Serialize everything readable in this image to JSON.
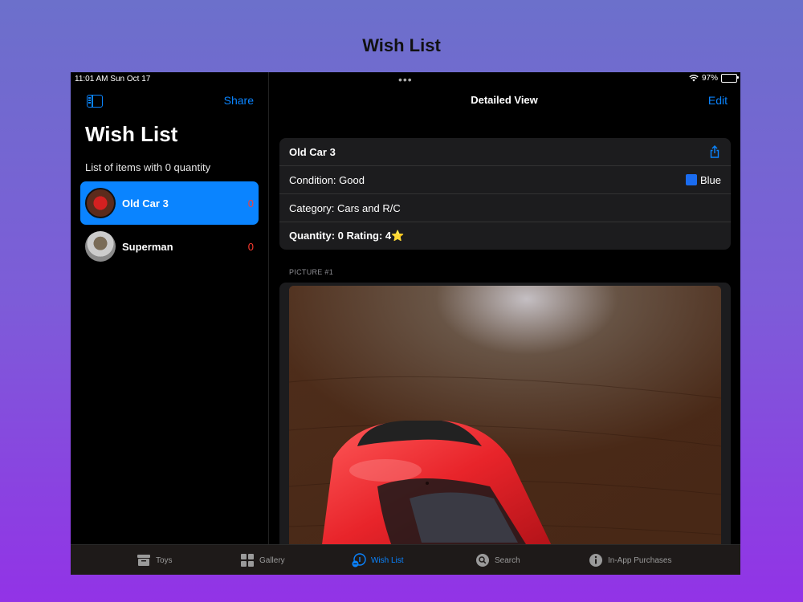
{
  "page": {
    "title": "Wish List"
  },
  "status_bar": {
    "time": "11:01 AM  Sun Oct 17",
    "battery": "97%",
    "battery_level": 0.97
  },
  "sidebar": {
    "share_label": "Share",
    "title": "Wish List",
    "subtitle": "List of items with 0 quantity",
    "items": [
      {
        "name": "Old Car 3",
        "count": "0",
        "selected": true
      },
      {
        "name": "Superman",
        "count": "0",
        "selected": false
      }
    ]
  },
  "detail": {
    "nav_title": "Detailed View",
    "edit_label": "Edit",
    "item_name": "Old Car 3",
    "condition": "Condition: Good",
    "color": "Blue",
    "category": "Category: Cars and R/C",
    "quantity_rating": "Quantity: 0  Rating: 4",
    "rating_icon": "star-icon",
    "picture_header": "PICTURE #1"
  },
  "tabbar": {
    "tabs": [
      {
        "label": "Toys",
        "icon": "archive-box-icon",
        "active": false
      },
      {
        "label": "Gallery",
        "icon": "grid-icon",
        "active": false
      },
      {
        "label": "Wish List",
        "icon": "wish-list-icon",
        "active": true
      },
      {
        "label": "Search",
        "icon": "search-icon",
        "active": false
      },
      {
        "label": "In-App Purchases",
        "icon": "info-icon",
        "active": false
      }
    ]
  },
  "colors": {
    "accent": "#0a84ff",
    "count_red": "#ff3b30",
    "swatch_blue": "#1a6cf0"
  }
}
